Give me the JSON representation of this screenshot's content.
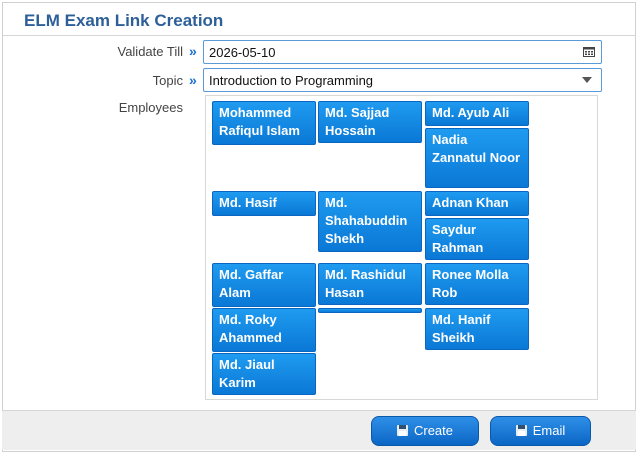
{
  "header": {
    "title": "ELM Exam Link Creation"
  },
  "form": {
    "validate_label": "Validate Till",
    "validate_value": "2026-05-10",
    "topic_label": "Topic",
    "topic_value": "Introduction to Programming",
    "employees_label": "Employees",
    "chevron": "»"
  },
  "employees": {
    "col1": [
      "Mohammed Rafiqul Islam",
      "Md. Hasif",
      "Md. Gaffar Alam",
      "Md. Roky Ahammed",
      "Md. Jiaul Karim"
    ],
    "col2": [
      "Md. Sajjad Hossain",
      "Md. Shahabuddin Shekh",
      "Md. Rashidul Hasan",
      ""
    ],
    "col3": [
      "Md. Ayub Ali",
      "Nadia Zannatul Noor",
      "Adnan Khan",
      "Saydur Rahman",
      "Ronee Molla Rob",
      "Md. Hanif Sheikh"
    ]
  },
  "buttons": {
    "create": "Create",
    "email": "Email"
  },
  "icons": {
    "calendar": "calendar-icon",
    "save": "floppy-disk-icon",
    "dropdown": "chevron-down-icon"
  },
  "colors": {
    "accent": "#1a6fd0",
    "tile": "#0a78d6",
    "title": "#2d5f99"
  }
}
